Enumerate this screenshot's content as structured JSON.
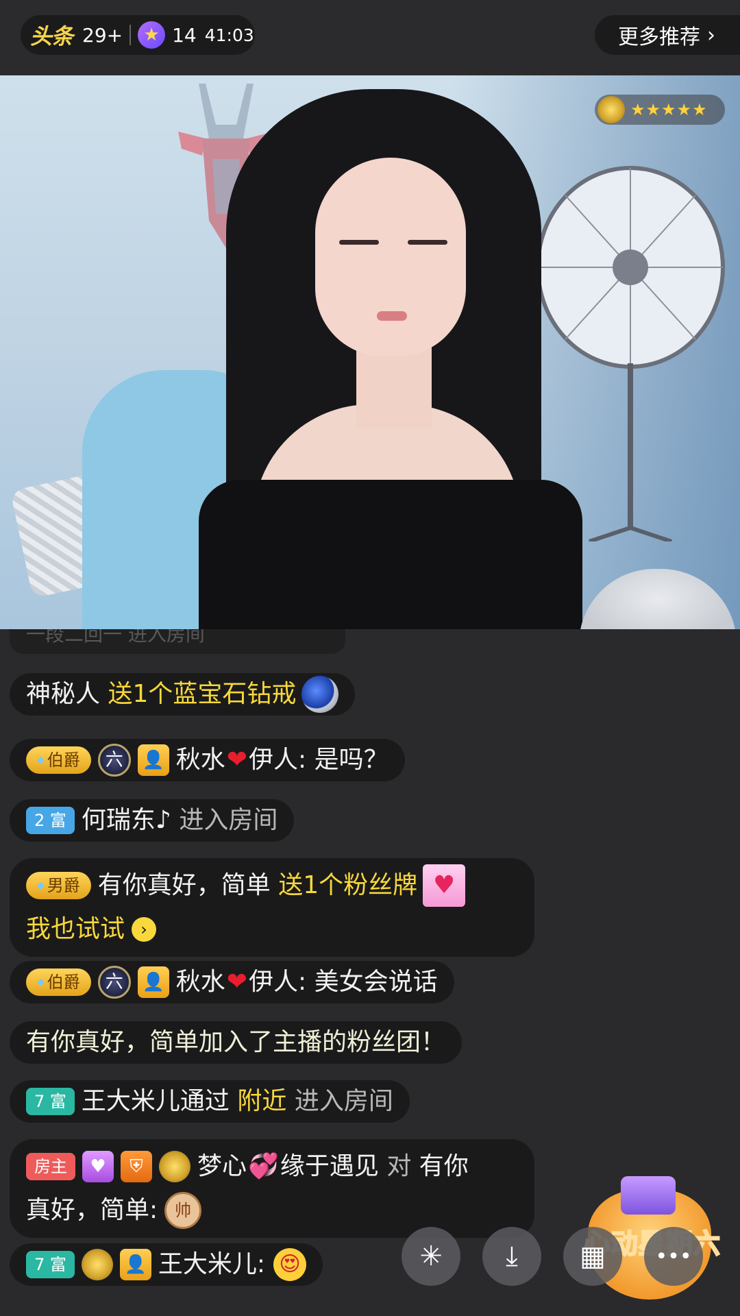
{
  "top_bar": {
    "app_logo": "头条",
    "viewer_count": "29+",
    "star_icon": "star-icon",
    "level": "14",
    "time": "41:03",
    "more_label": "更多推荐",
    "more_chevron": "›"
  },
  "video": {
    "anchor_stars": "★★★★★"
  },
  "chat": {
    "faded_text": "一段二回一 进入房间",
    "messages": [
      {
        "user": "神秘人",
        "action": "送1个蓝宝石钻戒",
        "gift_icon": "sapphire-ring-icon"
      },
      {
        "tag": "伯爵",
        "user": "秋水",
        "user_suffix": "伊人:",
        "text": "是吗？"
      },
      {
        "tag": "2 富",
        "user": "何瑞东♪",
        "action": "进入房间"
      },
      {
        "tag": "男爵",
        "user": "有你真好，简单",
        "action": "送1个粉丝牌",
        "gift_icon": "fan-badge-icon",
        "link": "我也试试"
      },
      {
        "tag": "伯爵",
        "user": "秋水",
        "user_suffix": "伊人:",
        "text": "美女会说话"
      },
      {
        "text": "有你真好，简单加入了主播的粉丝团！"
      },
      {
        "tag": "7 富",
        "user": "王大米儿通过",
        "highlight": "附近",
        "action": "进入房间"
      },
      {
        "tag": "房主",
        "user": "梦心",
        "user_suffix": "缘于遇见",
        "connector": "对",
        "target": "有你",
        "line2": "真好，简单:",
        "badge": "帅"
      },
      {
        "tag": "7 富",
        "user": "王大米儿:",
        "emoji": "heart-eyes-emoji"
      }
    ]
  },
  "promo": {
    "label": "心动星期六"
  },
  "bottom_actions": {
    "share_icon": "✳",
    "download_icon": "⤓",
    "grid_icon": "▦",
    "more_icon": "•••"
  }
}
